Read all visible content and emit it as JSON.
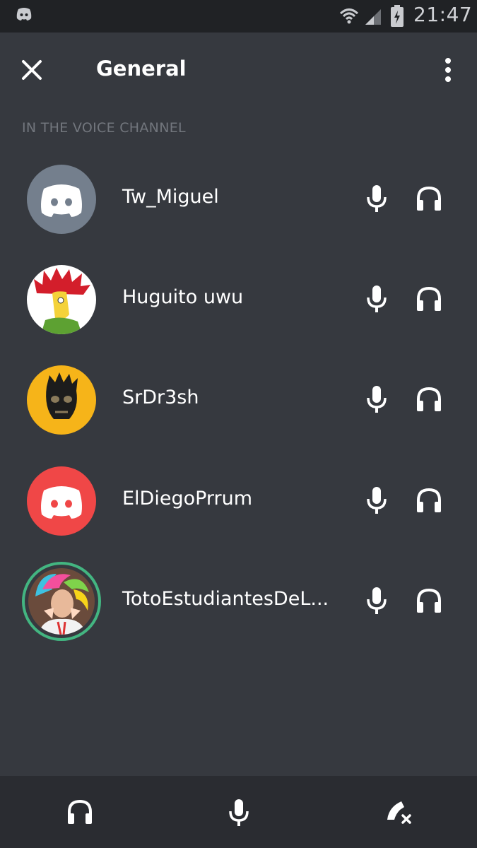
{
  "status_bar": {
    "time": "21:47",
    "icons": [
      "discord-icon",
      "wifi-icon",
      "signal-icon",
      "battery-icon"
    ]
  },
  "header": {
    "title": "General",
    "close_icon": "close-icon",
    "menu_icon": "more-vertical-icon"
  },
  "section": {
    "label": "IN THE VOICE CHANNEL"
  },
  "members": [
    {
      "name": "Tw_Miguel",
      "avatar": "discord-default-grey"
    },
    {
      "name": "Huguito uwu",
      "avatar": "sideshow-bob-picture"
    },
    {
      "name": "SrDr3sh",
      "avatar": "skull-on-yellow-picture"
    },
    {
      "name": "ElDiegoPrrum",
      "avatar": "discord-default-red"
    },
    {
      "name": "TotoEstudiantesDeL...",
      "avatar": "rainbow-hair-picture",
      "speaking": true
    }
  ],
  "member_controls": [
    "microphone-icon",
    "headset-icon"
  ],
  "bottom_bar": {
    "buttons": [
      "headset-icon",
      "microphone-icon",
      "disconnect-call-icon"
    ]
  },
  "colors": {
    "background": "#36393f",
    "status_bar": "#202225",
    "bottom_bar": "#2a2c31",
    "section_label": "#72767d",
    "speaking_ring": "#43b581",
    "discord_grey": "#747f8d",
    "discord_red": "#f04747"
  }
}
